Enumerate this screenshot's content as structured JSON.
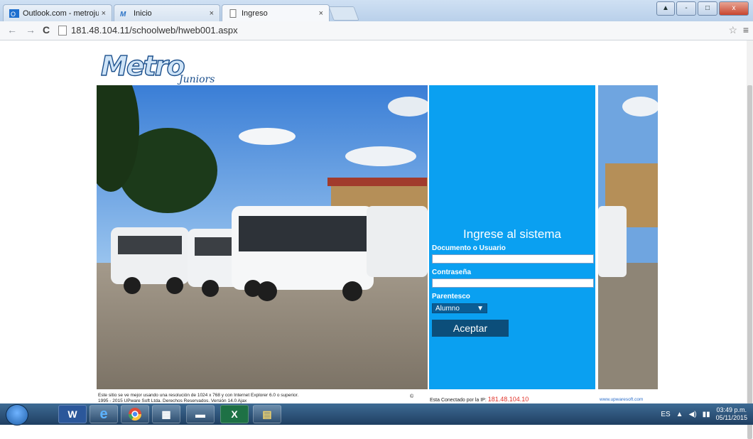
{
  "browser": {
    "tabs": [
      {
        "label": "Outlook.com - metrojunio",
        "active": false
      },
      {
        "label": "Inicio",
        "active": false
      },
      {
        "label": "Ingreso",
        "active": true
      }
    ],
    "url": "181.48.104.11/schoolweb/hweb001.aspx",
    "window_buttons": [
      "-",
      "□",
      "x"
    ]
  },
  "logo": {
    "text": "Metro",
    "script": "Juniors"
  },
  "login": {
    "title": "Ingrese al sistema",
    "user_label": "Documento o Usuario",
    "user_value": "",
    "password_label": "Contraseña",
    "password_value": "",
    "relation_label": "Parentesco",
    "relation_selected": "Alumno",
    "submit_label": "Aceptar"
  },
  "footer": {
    "line1": "Este sitio se ve mejor usando una resolución de 1024 x 768 y con Internet Explorer 6.0 o superior.",
    "line2": "1995 - 2015 UPware Soft Ltda. Derechos Reservados. Versión 14.0 Ajax",
    "copyright": "©",
    "ip_prefix": "Esta Conectado por la IP:",
    "ip": "181.48.104.10",
    "site": "www.upwaresoft.com"
  },
  "taskbar": {
    "apps": [
      "Word",
      "Internet Explorer",
      "Chrome",
      "Calculator",
      "Explorer",
      "Excel",
      "Notepad"
    ],
    "lang": "ES",
    "time": "03:49 p.m.",
    "date": "05/11/2015"
  },
  "colors": {
    "panel": "#0aa0f1",
    "button": "#0c4e7a",
    "ip": "#e0322a"
  }
}
